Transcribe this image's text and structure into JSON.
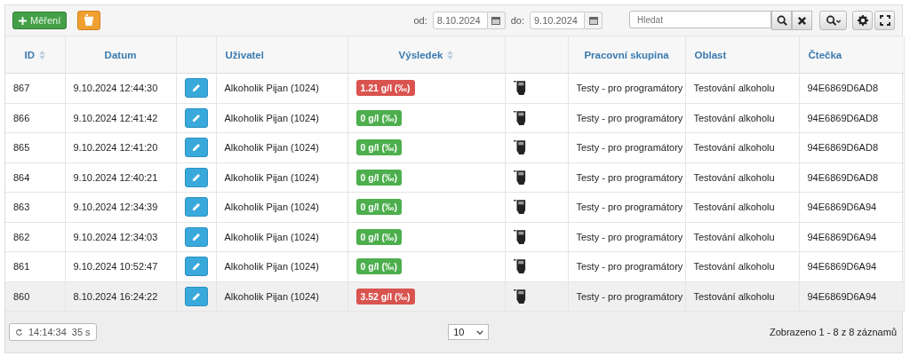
{
  "toolbar": {
    "add_button": "Měření",
    "date_from": {
      "label": "od:",
      "value": "8.10.2024"
    },
    "date_to": {
      "label": "do:",
      "value": "9.10.2024"
    },
    "search": {
      "placeholder": "Hledat"
    }
  },
  "table": {
    "columns": [
      {
        "kind": "label",
        "label": "ID",
        "sortable": true
      },
      {
        "kind": "label",
        "label": "Datum",
        "sortable": false
      },
      {
        "kind": "blank"
      },
      {
        "kind": "label",
        "label": "Uživatel",
        "sortable": false
      },
      {
        "kind": "label",
        "label": "Výsledek",
        "sortable": true
      },
      {
        "kind": "blank"
      },
      {
        "kind": "label",
        "label": "Pracovní skupina",
        "sortable": false
      },
      {
        "kind": "label",
        "label": "Oblast",
        "sortable": false
      },
      {
        "kind": "label",
        "label": "Čtečka",
        "sortable": false
      }
    ],
    "rows": [
      {
        "id": "867",
        "date": "9.10.2024 12:44:30",
        "user": "Alkoholik Pijan (1024)",
        "result": "1.21 g/l (‰)",
        "kind": "positive",
        "group": "Testy - pro programátory",
        "area": "Testování alkoholu",
        "reader": "94E6869D6AD8",
        "selected": false
      },
      {
        "id": "866",
        "date": "9.10.2024 12:41:42",
        "user": "Alkoholik Pijan (1024)",
        "result": "0 g/l (‰)",
        "kind": "negative",
        "group": "Testy - pro programátory",
        "area": "Testování alkoholu",
        "reader": "94E6869D6AD8",
        "selected": false
      },
      {
        "id": "865",
        "date": "9.10.2024 12:41:20",
        "user": "Alkoholik Pijan (1024)",
        "result": "0 g/l (‰)",
        "kind": "negative",
        "group": "Testy - pro programátory",
        "area": "Testování alkoholu",
        "reader": "94E6869D6AD8",
        "selected": false
      },
      {
        "id": "864",
        "date": "9.10.2024 12:40:21",
        "user": "Alkoholik Pijan (1024)",
        "result": "0 g/l (‰)",
        "kind": "negative",
        "group": "Testy - pro programátory",
        "area": "Testování alkoholu",
        "reader": "94E6869D6AD8",
        "selected": false
      },
      {
        "id": "863",
        "date": "9.10.2024 12:34:39",
        "user": "Alkoholik Pijan (1024)",
        "result": "0 g/l (‰)",
        "kind": "negative",
        "group": "Testy - pro programátory",
        "area": "Testování alkoholu",
        "reader": "94E6869D6A94",
        "selected": false
      },
      {
        "id": "862",
        "date": "9.10.2024 12:34:03",
        "user": "Alkoholik Pijan (1024)",
        "result": "0 g/l (‰)",
        "kind": "negative",
        "group": "Testy - pro programátory",
        "area": "Testování alkoholu",
        "reader": "94E6869D6A94",
        "selected": false
      },
      {
        "id": "861",
        "date": "9.10.2024 10:52:47",
        "user": "Alkoholik Pijan (1024)",
        "result": "0 g/l (‰)",
        "kind": "negative",
        "group": "Testy - pro programátory",
        "area": "Testování alkoholu",
        "reader": "94E6869D6A94",
        "selected": false
      },
      {
        "id": "860",
        "date": "8.10.2024 16:24:22",
        "user": "Alkoholik Pijan (1024)",
        "result": "3.52 g/l (‰)",
        "kind": "positive",
        "group": "Testy - pro programátory",
        "area": "Testování alkoholu",
        "reader": "94E6869D6A94",
        "selected": true
      }
    ]
  },
  "footer": {
    "refresh": {
      "time": "14:14:34",
      "interval": "35 s"
    },
    "page_size": "10",
    "summary": "Zobrazeno 1 - 8 z 8 záznamů"
  }
}
